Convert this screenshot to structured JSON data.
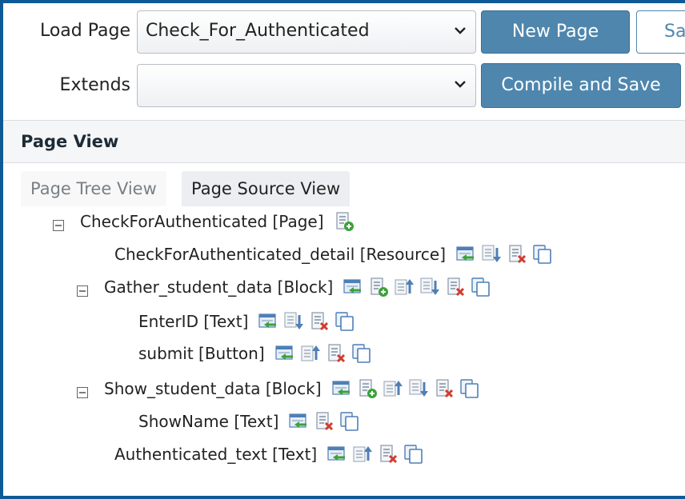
{
  "toolbar": {
    "load_page_label": "Load Page",
    "load_page_value": "Check_For_Authenticated",
    "extends_label": "Extends",
    "extends_value": "",
    "new_page_label": "New Page",
    "save_label": "Sa",
    "compile_save_label": "Compile and Save"
  },
  "page_view": {
    "title": "Page View",
    "tabs": [
      {
        "label": "Page Tree View",
        "active": false
      },
      {
        "label": "Page Source View",
        "active": true
      }
    ]
  },
  "tree": [
    {
      "label": "CheckForAuthenticated [Page]",
      "collapsible": true,
      "icons": [
        "add-child-icon"
      ]
    },
    {
      "label": "CheckForAuthenticated_detail [Resource]",
      "collapsible": false,
      "icons": [
        "insert-before-icon",
        "move-down-icon",
        "delete-icon",
        "copy-icon"
      ]
    },
    {
      "label": "Gather_student_data [Block]",
      "collapsible": true,
      "icons": [
        "insert-before-icon",
        "add-child-icon",
        "move-up-icon",
        "move-down-icon",
        "delete-icon",
        "copy-icon"
      ]
    },
    {
      "label": "EnterID [Text]",
      "collapsible": false,
      "icons": [
        "insert-before-icon",
        "move-down-icon",
        "delete-icon",
        "copy-icon"
      ]
    },
    {
      "label": "submit [Button]",
      "collapsible": false,
      "icons": [
        "insert-before-icon",
        "move-up-icon",
        "delete-icon",
        "copy-icon"
      ]
    },
    {
      "label": "Show_student_data [Block]",
      "collapsible": true,
      "icons": [
        "insert-before-icon",
        "add-child-icon",
        "move-up-icon",
        "move-down-icon",
        "delete-icon",
        "copy-icon"
      ]
    },
    {
      "label": "ShowName [Text]",
      "collapsible": false,
      "icons": [
        "insert-before-icon",
        "delete-icon",
        "copy-icon"
      ]
    },
    {
      "label": "Authenticated_text [Text]",
      "collapsible": false,
      "icons": [
        "insert-before-icon",
        "move-up-icon",
        "delete-icon",
        "copy-icon"
      ]
    }
  ],
  "colors": {
    "frame": "#0f5a96",
    "button": "#4f86ad",
    "icon_green": "#3aa23a",
    "icon_blue": "#4f7fb5",
    "icon_red": "#d23b2e"
  }
}
